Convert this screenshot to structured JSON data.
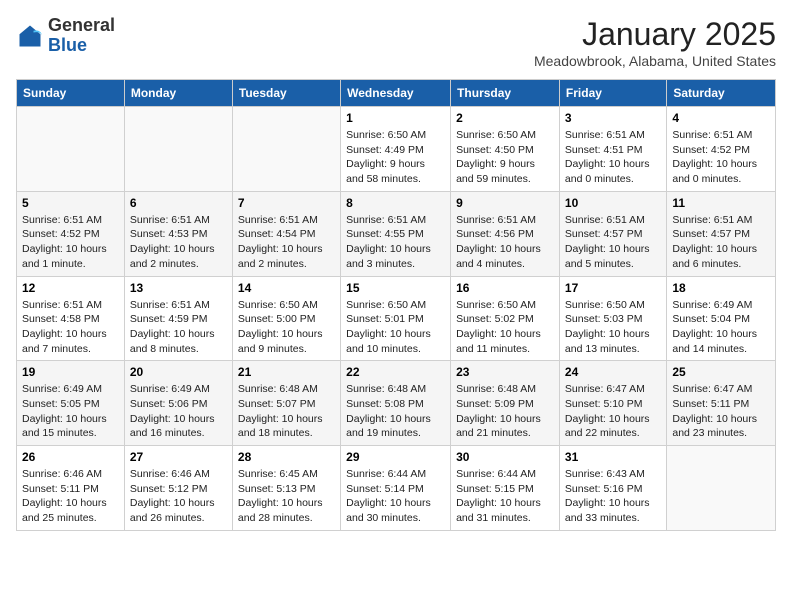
{
  "header": {
    "logo_general": "General",
    "logo_blue": "Blue",
    "month_title": "January 2025",
    "location": "Meadowbrook, Alabama, United States"
  },
  "days_of_week": [
    "Sunday",
    "Monday",
    "Tuesday",
    "Wednesday",
    "Thursday",
    "Friday",
    "Saturday"
  ],
  "weeks": [
    [
      {
        "day": "",
        "info": ""
      },
      {
        "day": "",
        "info": ""
      },
      {
        "day": "",
        "info": ""
      },
      {
        "day": "1",
        "info": "Sunrise: 6:50 AM\nSunset: 4:49 PM\nDaylight: 9 hours and 58 minutes."
      },
      {
        "day": "2",
        "info": "Sunrise: 6:50 AM\nSunset: 4:50 PM\nDaylight: 9 hours and 59 minutes."
      },
      {
        "day": "3",
        "info": "Sunrise: 6:51 AM\nSunset: 4:51 PM\nDaylight: 10 hours and 0 minutes."
      },
      {
        "day": "4",
        "info": "Sunrise: 6:51 AM\nSunset: 4:52 PM\nDaylight: 10 hours and 0 minutes."
      }
    ],
    [
      {
        "day": "5",
        "info": "Sunrise: 6:51 AM\nSunset: 4:52 PM\nDaylight: 10 hours and 1 minute."
      },
      {
        "day": "6",
        "info": "Sunrise: 6:51 AM\nSunset: 4:53 PM\nDaylight: 10 hours and 2 minutes."
      },
      {
        "day": "7",
        "info": "Sunrise: 6:51 AM\nSunset: 4:54 PM\nDaylight: 10 hours and 2 minutes."
      },
      {
        "day": "8",
        "info": "Sunrise: 6:51 AM\nSunset: 4:55 PM\nDaylight: 10 hours and 3 minutes."
      },
      {
        "day": "9",
        "info": "Sunrise: 6:51 AM\nSunset: 4:56 PM\nDaylight: 10 hours and 4 minutes."
      },
      {
        "day": "10",
        "info": "Sunrise: 6:51 AM\nSunset: 4:57 PM\nDaylight: 10 hours and 5 minutes."
      },
      {
        "day": "11",
        "info": "Sunrise: 6:51 AM\nSunset: 4:57 PM\nDaylight: 10 hours and 6 minutes."
      }
    ],
    [
      {
        "day": "12",
        "info": "Sunrise: 6:51 AM\nSunset: 4:58 PM\nDaylight: 10 hours and 7 minutes."
      },
      {
        "day": "13",
        "info": "Sunrise: 6:51 AM\nSunset: 4:59 PM\nDaylight: 10 hours and 8 minutes."
      },
      {
        "day": "14",
        "info": "Sunrise: 6:50 AM\nSunset: 5:00 PM\nDaylight: 10 hours and 9 minutes."
      },
      {
        "day": "15",
        "info": "Sunrise: 6:50 AM\nSunset: 5:01 PM\nDaylight: 10 hours and 10 minutes."
      },
      {
        "day": "16",
        "info": "Sunrise: 6:50 AM\nSunset: 5:02 PM\nDaylight: 10 hours and 11 minutes."
      },
      {
        "day": "17",
        "info": "Sunrise: 6:50 AM\nSunset: 5:03 PM\nDaylight: 10 hours and 13 minutes."
      },
      {
        "day": "18",
        "info": "Sunrise: 6:49 AM\nSunset: 5:04 PM\nDaylight: 10 hours and 14 minutes."
      }
    ],
    [
      {
        "day": "19",
        "info": "Sunrise: 6:49 AM\nSunset: 5:05 PM\nDaylight: 10 hours and 15 minutes."
      },
      {
        "day": "20",
        "info": "Sunrise: 6:49 AM\nSunset: 5:06 PM\nDaylight: 10 hours and 16 minutes."
      },
      {
        "day": "21",
        "info": "Sunrise: 6:48 AM\nSunset: 5:07 PM\nDaylight: 10 hours and 18 minutes."
      },
      {
        "day": "22",
        "info": "Sunrise: 6:48 AM\nSunset: 5:08 PM\nDaylight: 10 hours and 19 minutes."
      },
      {
        "day": "23",
        "info": "Sunrise: 6:48 AM\nSunset: 5:09 PM\nDaylight: 10 hours and 21 minutes."
      },
      {
        "day": "24",
        "info": "Sunrise: 6:47 AM\nSunset: 5:10 PM\nDaylight: 10 hours and 22 minutes."
      },
      {
        "day": "25",
        "info": "Sunrise: 6:47 AM\nSunset: 5:11 PM\nDaylight: 10 hours and 23 minutes."
      }
    ],
    [
      {
        "day": "26",
        "info": "Sunrise: 6:46 AM\nSunset: 5:11 PM\nDaylight: 10 hours and 25 minutes."
      },
      {
        "day": "27",
        "info": "Sunrise: 6:46 AM\nSunset: 5:12 PM\nDaylight: 10 hours and 26 minutes."
      },
      {
        "day": "28",
        "info": "Sunrise: 6:45 AM\nSunset: 5:13 PM\nDaylight: 10 hours and 28 minutes."
      },
      {
        "day": "29",
        "info": "Sunrise: 6:44 AM\nSunset: 5:14 PM\nDaylight: 10 hours and 30 minutes."
      },
      {
        "day": "30",
        "info": "Sunrise: 6:44 AM\nSunset: 5:15 PM\nDaylight: 10 hours and 31 minutes."
      },
      {
        "day": "31",
        "info": "Sunrise: 6:43 AM\nSunset: 5:16 PM\nDaylight: 10 hours and 33 minutes."
      },
      {
        "day": "",
        "info": ""
      }
    ]
  ]
}
